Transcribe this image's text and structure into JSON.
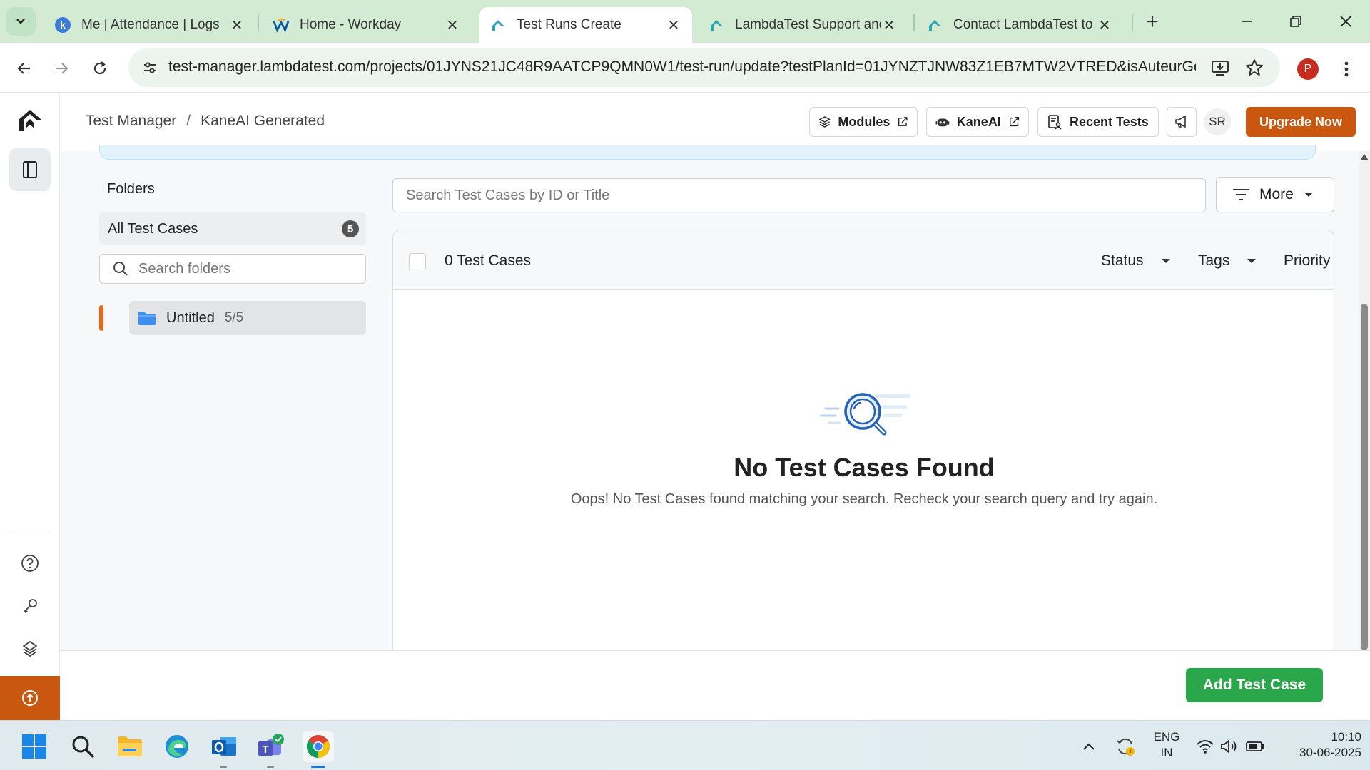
{
  "browser": {
    "tabs": [
      {
        "title": "Me | Attendance | Logs",
        "favicon": "k-logo-icon"
      },
      {
        "title": "Home - Workday",
        "favicon": "workday-logo-icon"
      },
      {
        "title": "Test Runs Create",
        "favicon": "lambdatest-logo-icon",
        "active": true
      },
      {
        "title": "LambdaTest Support and",
        "favicon": "lambdatest-logo-icon"
      },
      {
        "title": "Contact LambdaTest to F",
        "favicon": "lambdatest-logo-icon"
      }
    ],
    "url": "test-manager.lambdatest.com/projects/01JYNS21JC48R9AATCP9QMN0W1/test-run/update?testPlanId=01JYNZTJNW83Z1EB7MTW2VTRED&isAuteurGen...",
    "profile_initial": "P"
  },
  "header": {
    "breadcrumb": [
      "Test Manager",
      "KaneAI Generated"
    ],
    "buttons": {
      "modules": "Modules",
      "kaneai": "KaneAI",
      "recent_tests": "Recent Tests"
    },
    "avatar": "SR",
    "upgrade": "Upgrade Now"
  },
  "folders": {
    "title": "Folders",
    "all_cases_label": "All Test Cases",
    "all_cases_count": "5",
    "search_placeholder": "Search folders",
    "items": [
      {
        "name": "Untitled",
        "count": "5/5"
      }
    ]
  },
  "cases": {
    "search_placeholder": "Search Test Cases by ID or Title",
    "more_label": "More",
    "count_label": "0 Test Cases",
    "filters": [
      "Status",
      "Tags",
      "Priority"
    ],
    "empty_title": "No Test Cases Found",
    "empty_desc": "Oops! No Test Cases found matching your search. Recheck your search query and try again."
  },
  "footer": {
    "add_button": "Add Test Case"
  },
  "taskbar": {
    "lang_top": "ENG",
    "lang_bottom": "IN",
    "time": "10:10",
    "date": "30-06-2025"
  },
  "colors": {
    "brand_orange": "#c9570f",
    "success_green": "#29a74a",
    "tab_bar": "#d3ead3",
    "folder_blue": "#3d8ef0"
  }
}
